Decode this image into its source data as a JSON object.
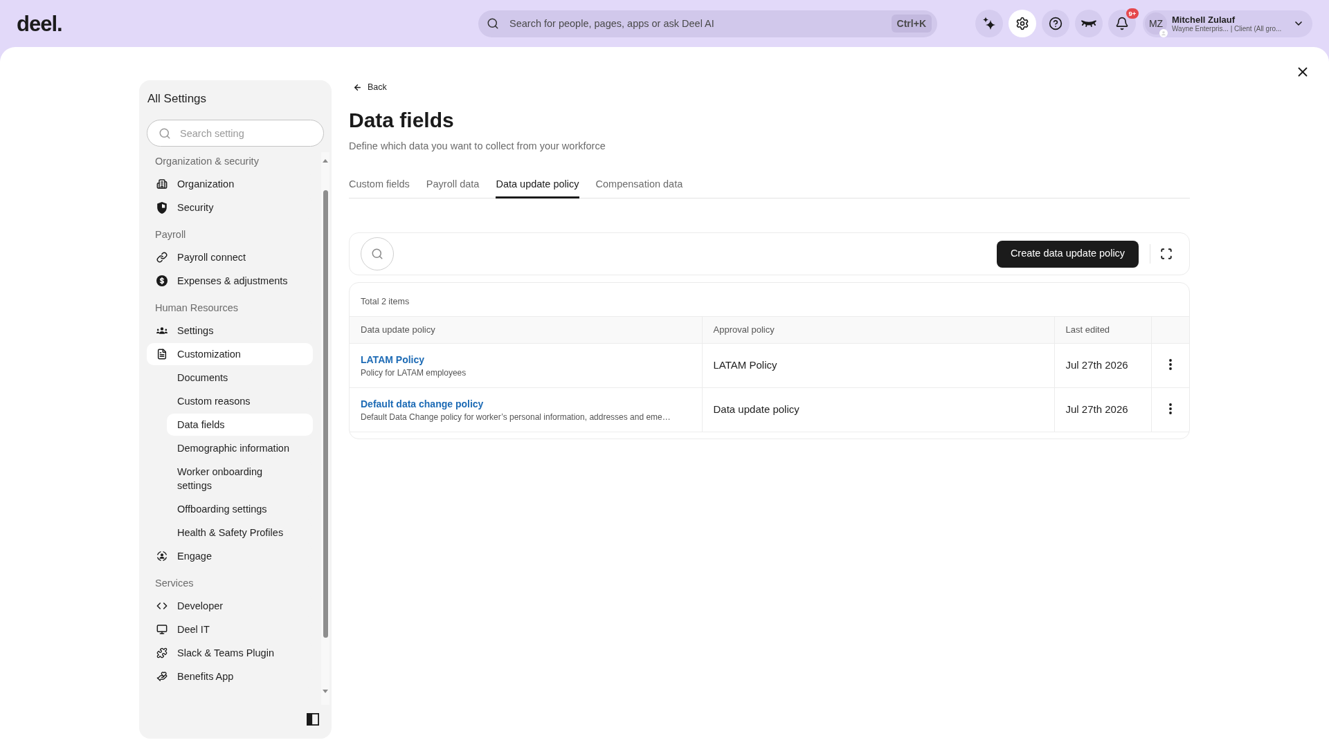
{
  "top_bar": {
    "logo": "deel.",
    "search": {
      "placeholder": "Search for people, pages, apps or ask Deel AI",
      "shortcut": "Ctrl+K"
    },
    "icon_buttons": [
      {
        "kind": "sparkle",
        "selected": false
      },
      {
        "kind": "settings",
        "selected": true
      },
      {
        "kind": "help",
        "selected": false
      },
      {
        "kind": "eye_closed",
        "selected": false
      },
      {
        "kind": "bell",
        "selected": false,
        "badge": "9+"
      }
    ],
    "user": {
      "initials": "MZ",
      "name": "Mitchell Zulauf",
      "subtitle": "Wayne Enterpris... | Client (All gro..."
    }
  },
  "sidebar": {
    "title": "All Settings",
    "search": {
      "placeholder": "Search setting"
    },
    "sections": [
      {
        "label": "Organization & security",
        "items": [
          {
            "label": "Organization",
            "selected": false
          },
          {
            "label": "Security",
            "selected": false
          }
        ]
      },
      {
        "label": "Payroll",
        "items": [
          {
            "label": "Payroll connect",
            "selected": false
          },
          {
            "label": "Expenses & adjustments",
            "selected": false
          }
        ]
      },
      {
        "label": "Human Resources",
        "items": [
          {
            "label": "Settings",
            "selected": false
          },
          {
            "label": "Customization",
            "selected": true,
            "children": [
              {
                "label": "Documents",
                "selected": false
              },
              {
                "label": "Custom reasons",
                "selected": false
              },
              {
                "label": "Data fields",
                "selected": true
              },
              {
                "label": "Demographic information",
                "selected": false
              },
              {
                "label": "Worker onboarding settings",
                "selected": false
              },
              {
                "label": "Offboarding settings",
                "selected": false
              },
              {
                "label": "Health & Safety Profiles",
                "selected": false
              }
            ]
          },
          {
            "label": "Engage",
            "selected": false
          }
        ]
      },
      {
        "label": "Services",
        "items": [
          {
            "label": "Developer",
            "selected": false
          },
          {
            "label": "Deel IT",
            "selected": false
          },
          {
            "label": "Slack & Teams Plugin",
            "selected": false
          },
          {
            "label": "Benefits App",
            "selected": false
          }
        ]
      }
    ]
  },
  "page": {
    "back": "Back",
    "title": "Data fields",
    "subtitle": "Define which data you want to collect from your workforce",
    "tabs": [
      {
        "label": "Custom fields",
        "selected": false
      },
      {
        "label": "Payroll data",
        "selected": false
      },
      {
        "label": "Data update policy",
        "selected": true
      },
      {
        "label": "Compensation data",
        "selected": false
      }
    ]
  },
  "toolbar": {
    "button": "Create data update policy"
  },
  "table": {
    "total": "Total 2 items",
    "columns": [
      "Data update policy",
      "Approval policy",
      "Last edited"
    ],
    "rows": [
      {
        "name": "LATAM Policy",
        "description": "Policy for LATAM employees",
        "approval_policy": "LATAM Policy",
        "last_edited": "Jul 27th 2026"
      },
      {
        "name": "Default data change policy",
        "description": "Default Data Change policy for worker’s personal information, addresses and eme…",
        "approval_policy": "Data update policy",
        "last_edited": "Jul 27th 2026"
      }
    ]
  }
}
